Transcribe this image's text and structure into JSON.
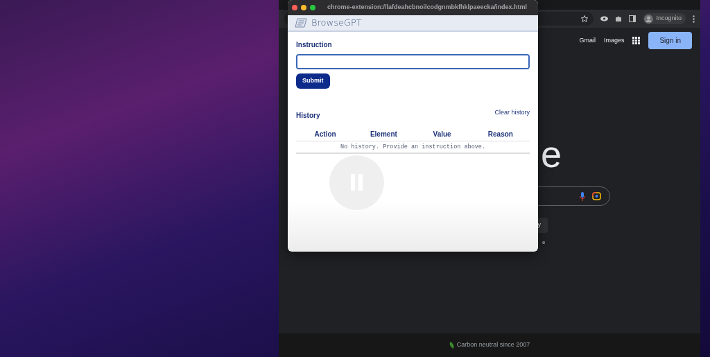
{
  "popup": {
    "url": "chrome-extension://lafdeahcbnoilcodgnmbkfhklpaeecka/index.html",
    "app_title": "BrowseGPT",
    "instruction_label": "Instruction",
    "submit_button": "Submit",
    "history_title": "History",
    "clear_history": "Clear history",
    "table": {
      "columns": [
        "Action",
        "Element",
        "Value",
        "Reason"
      ],
      "empty_message": "No history. Provide an instruction above."
    }
  },
  "browser": {
    "profile_label": "Incognito",
    "links": [
      "Gmail",
      "Images"
    ],
    "sign_in": "Sign in",
    "logo_fragment": "e",
    "button_fragment": "y",
    "text_fragment": "e",
    "footer": "Carbon neutral since 2007"
  }
}
